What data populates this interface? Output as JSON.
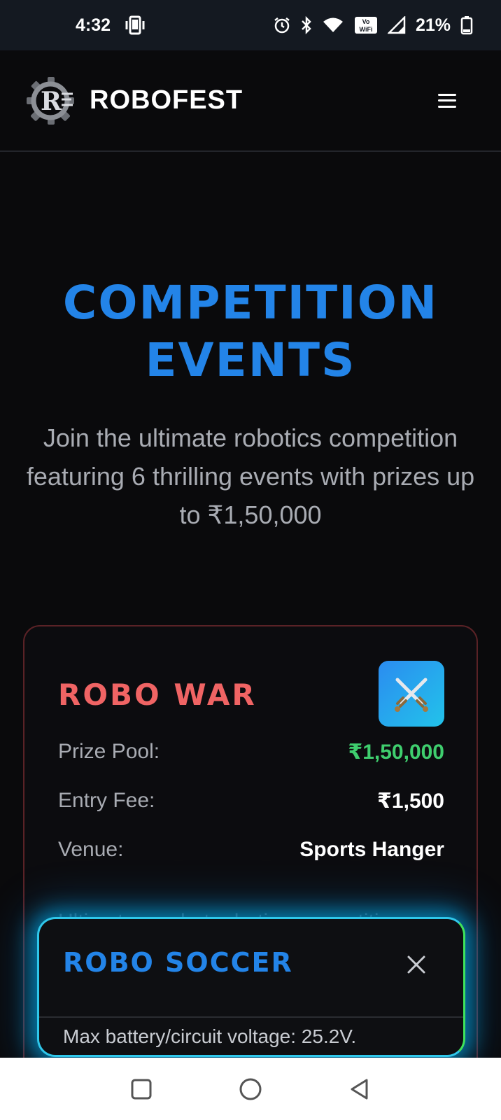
{
  "status_bar": {
    "time": "4:32",
    "battery": "21%",
    "icons": [
      "phone-vibrate-icon",
      "alarm-icon",
      "bluetooth-icon",
      "wifi-icon",
      "vowifi-icon",
      "signal-icon",
      "battery-icon"
    ],
    "vowifi_top": "Vo",
    "vowifi_bottom": "WiFi"
  },
  "header": {
    "brand": "ROBOFEST",
    "logo_letter": "R",
    "menu_icon": "hamburger-menu-icon"
  },
  "hero": {
    "title_line1": "COMPETITION",
    "title_line2": "EVENTS",
    "subtitle": "Join the ultimate robotics competition featuring 6 thrilling events with prizes up to ₹1,50,000"
  },
  "event_card": {
    "title": "ROBO WAR",
    "icon": "crossed-swords-icon",
    "prize_label": "Prize Pool:",
    "prize_value": "₹1,50,000",
    "fee_label": "Entry Fee:",
    "fee_value": "₹1,500",
    "venue_label": "Venue:",
    "venue_value": "Sports Hanger",
    "description": "Ultimate combat robotics competition"
  },
  "sheet": {
    "title": "ROBO SOCCER",
    "close_icon": "close-icon",
    "text": "Max battery/circuit voltage: 25.2V."
  },
  "nav_bar": {
    "buttons": [
      "recent-apps-icon",
      "home-icon",
      "back-icon"
    ]
  },
  "colors": {
    "accent_blue": "#2384e8",
    "card_title_red": "#f06464",
    "prize_green": "#3fce6e",
    "glow_cyan": "#2fc7ea",
    "glow_green": "#40e25a"
  }
}
